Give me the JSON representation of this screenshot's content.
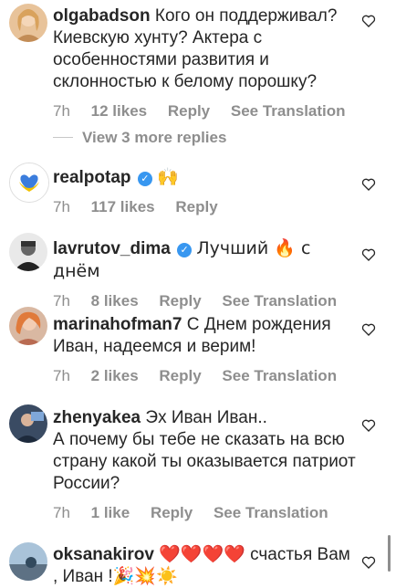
{
  "comments": [
    {
      "username": "olgabadson",
      "text": "Кого он поддерживал? Киевскую хунту? Актера с особенностями развития и склонностью к белому порошку?",
      "time": "7h",
      "likes": "12 likes",
      "reply": "Reply",
      "translation": "See Translation"
    },
    {
      "username": "realpotap",
      "text": "🙌",
      "time": "7h",
      "likes": "117 likes",
      "reply": "Reply"
    },
    {
      "username": "lavrutov_dima",
      "text": "Лучший 🔥 с днём",
      "time": "7h",
      "likes": "8 likes",
      "reply": "Reply",
      "translation": "See Translation"
    },
    {
      "username": "marinahofman7",
      "text": "С Днем рождения Иван, надеемся и верим!",
      "time": "7h",
      "likes": "2 likes",
      "reply": "Reply",
      "translation": "See Translation"
    },
    {
      "username": "zhenyakea",
      "text": "Эх Иван Иван..",
      "text2": "А почему бы тебе не сказать на всю страну какой ты оказывается патриот России?",
      "time": "7h",
      "likes": "1 like",
      "reply": "Reply",
      "translation": "See Translation"
    },
    {
      "username": "oksanakirov",
      "text": "❤️❤️❤️❤️ счастья Вам , Иван !🎉💥☀️"
    }
  ],
  "view_replies": "View 3 more replies",
  "colors": {
    "verified": "#3897f0",
    "meta": "#8e8e8e",
    "text": "#262626"
  }
}
